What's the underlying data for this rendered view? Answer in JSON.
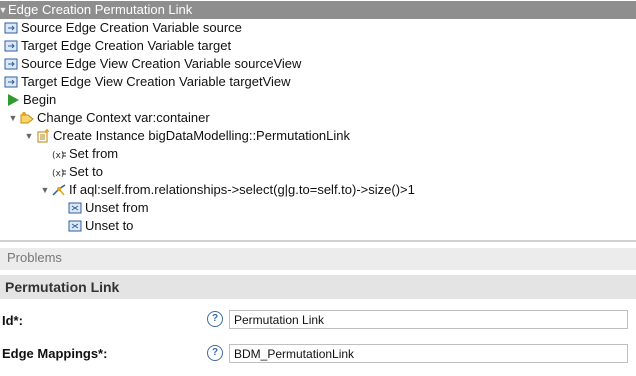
{
  "tree": {
    "root_label": "Edge Creation Permutation Link",
    "items": [
      {
        "label": "Source Edge Creation Variable source"
      },
      {
        "label": "Target Edge Creation Variable target"
      },
      {
        "label": "Source Edge View Creation Variable sourceView"
      },
      {
        "label": "Target Edge View Creation Variable targetView"
      },
      {
        "label": "Begin"
      },
      {
        "label": "Change Context var:container"
      },
      {
        "label": "Create Instance bigDataModelling::PermutationLink"
      },
      {
        "label": "Set from"
      },
      {
        "label": "Set to"
      },
      {
        "label": "If aql:self.from.relationships->select(g|g.to=self.to)->size()>1"
      },
      {
        "label": "Unset from"
      },
      {
        "label": "Unset to"
      }
    ]
  },
  "problems_tab": {
    "label": "Problems"
  },
  "section": {
    "title": "Permutation Link"
  },
  "properties": {
    "id_label": "Id*:",
    "id_value": "Permutation Link",
    "edge_mappings_label": "Edge Mappings*:",
    "edge_mappings_value": "BDM_PermutationLink"
  },
  "icons": {
    "help": "?",
    "expanded": "▼"
  },
  "colors": {
    "selection": "#8e8e8e",
    "begin_green": "#2e9b2e",
    "change_context_orange": "#e8a317",
    "variable_blue": "#2f5f9e"
  }
}
